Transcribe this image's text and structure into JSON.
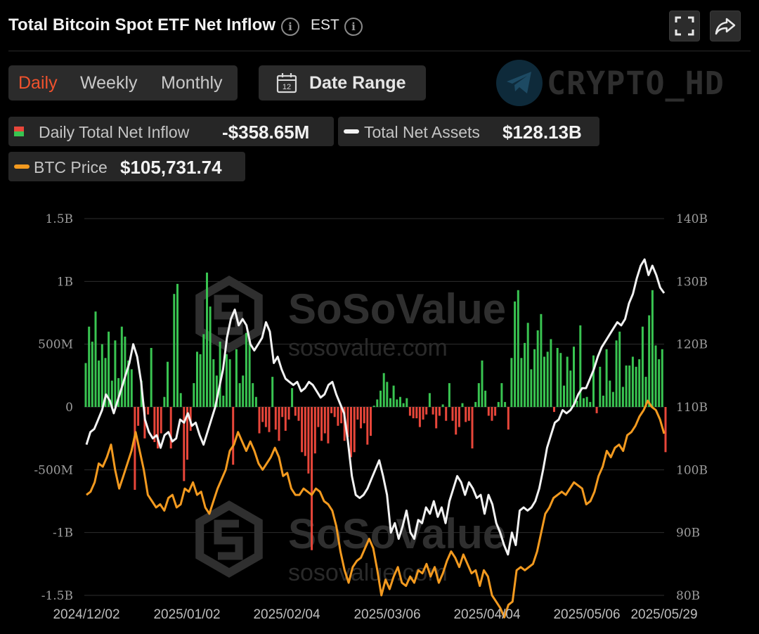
{
  "header": {
    "title": "Total Bitcoin Spot ETF Net Inflow",
    "timezone": "EST",
    "icons": [
      "info-icon",
      "info-icon",
      "fullscreen-icon",
      "share-icon"
    ]
  },
  "controls": {
    "periods": [
      "Daily",
      "Weekly",
      "Monthly"
    ],
    "active_period": "Daily",
    "date_range_label": "Date Range",
    "calendar_day": "12"
  },
  "brand_watermark": "CRYPTO_HD",
  "legend": {
    "inflow": {
      "label": "Daily Total Net Inflow",
      "value": "-$358.65M"
    },
    "assets": {
      "label": "Total Net Assets",
      "value": "$128.13B"
    },
    "price": {
      "label": "BTC Price",
      "value": "$105,731.74"
    }
  },
  "watermark": {
    "name": "SoSoValue",
    "url": "sosovalue.com"
  },
  "colors": {
    "positive": "#39c451",
    "negative": "#e8463a",
    "assets_line": "#f2f2f2",
    "price_line": "#f39a1f",
    "accent": "#f0522d"
  },
  "chart_data": {
    "type": "bar",
    "left_axis": {
      "ticks": [
        "1.5B",
        "1B",
        "500M",
        "0",
        "-500M",
        "-1B",
        "-1.5B"
      ],
      "range": [
        -1.5,
        1.5
      ],
      "unit": "B USD"
    },
    "right_axis": {
      "ticks": [
        "140B",
        "130B",
        "120B",
        "110B",
        "100B",
        "90B",
        "80B"
      ],
      "range": [
        80,
        140
      ],
      "unit": "B USD"
    },
    "x_ticks": [
      "2024/12/02",
      "2025/01/02",
      "2025/02/04",
      "2025/03/06",
      "2025/04/04",
      "2025/05/06",
      "2025/05/29"
    ],
    "grid": true,
    "series": [
      {
        "name": "Daily Total Net Inflow",
        "kind": "bar",
        "axis": "left",
        "unit": "B USD",
        "values": [
          0.35,
          0.64,
          0.52,
          0.76,
          0.37,
          0.5,
          0.39,
          0.6,
          0.21,
          0.53,
          0.23,
          0.64,
          0.56,
          0.37,
          0.3,
          -0.66,
          -0.15,
          0.21,
          -0.25,
          -0.06,
          0.47,
          -0.28,
          -0.33,
          -0.21,
          0.08,
          0.36,
          -0.33,
          0.9,
          0.98,
          0.11,
          -0.59,
          -0.42,
          -0.19,
          0.19,
          0.44,
          0.42,
          0.58,
          1.07,
          0.8,
          0.38,
          0.25,
          0.52,
          0.09,
          0.42,
          0.38,
          -0.46,
          0.46,
          0.19,
          0.25,
          0.59,
          0.54,
          0.19,
          0.08,
          -0.21,
          -0.12,
          -0.16,
          -0.2,
          0.24,
          -0.18,
          -0.27,
          -0.08,
          -0.19,
          -0.1,
          0.15,
          -0.07,
          -0.11,
          -0.36,
          -0.39,
          -0.53,
          -1.14,
          -0.37,
          -0.16,
          -0.27,
          -0.21,
          -0.29,
          -0.05,
          -0.08,
          -0.15,
          -0.13,
          -0.27,
          -0.24,
          -0.4,
          -0.36,
          -0.1,
          -0.17,
          -0.13,
          -0.3,
          -0.23,
          0.01,
          0.06,
          0.13,
          0.27,
          0.2,
          0.07,
          0.17,
          0.06,
          0.08,
          0.03,
          0.07,
          -0.07,
          -0.09,
          -0.09,
          -0.16,
          -0.1,
          -0.06,
          0.11,
          -0.06,
          -0.17,
          -0.07,
          0.02,
          -0.11,
          0.19,
          -0.11,
          -0.22,
          -0.16,
          0.03,
          -0.12,
          -0.11,
          -0.33,
          0.04,
          0.19,
          0.37,
          0.13,
          -0.07,
          -0.11,
          -0.07,
          0.04,
          0.19,
          0.04,
          -0.18,
          0.39,
          0.84,
          0.93,
          0.39,
          0.51,
          0.67,
          0.3,
          0.46,
          0.61,
          0.74,
          0.4,
          0.44,
          0.54,
          -0.04,
          0.47,
          0.43,
          0.17,
          0.4,
          0.29,
          0.48,
          0.05,
          0.65,
          0.07,
          0.08,
          0.04,
          0.41,
          -0.05,
          0.32,
          0.09,
          0.46,
          0.21,
          0.12,
          0.53,
          0.6,
          0.16,
          0.33,
          0.33,
          0.4,
          0.32,
          0.38,
          0.64,
          0.24,
          0.73,
          0.93,
          0.49,
          0.38,
          0.46,
          -0.36
        ],
        "colors": {
          "positive": "#39c451",
          "negative": "#e8463a"
        }
      },
      {
        "name": "Total Net Assets",
        "kind": "line",
        "axis": "right",
        "unit": "B USD",
        "values": [
          104.0,
          106.0,
          106.5,
          108.0,
          109.5,
          112.0,
          111.0,
          109.0,
          111.0,
          113.0,
          115.0,
          117.0,
          120.0,
          118.0,
          114.0,
          108.0,
          106.0,
          105.0,
          105.5,
          103.5,
          105.5,
          106.0,
          104.5,
          105.0,
          108.0,
          107.5,
          109.0,
          107.0,
          107.5,
          105.5,
          104.0,
          106.0,
          108.0,
          110.0,
          113.0,
          116.0,
          121.0,
          124.0,
          125.5,
          123.0,
          124.0,
          123.0,
          120.0,
          119.0,
          120.0,
          121.0,
          123.5,
          122.0,
          117.0,
          118.0,
          116.0,
          114.5,
          114.0,
          113.5,
          114.0,
          112.5,
          113.0,
          114.0,
          113.5,
          112.5,
          111.5,
          112.0,
          113.5,
          114.0,
          112.0,
          110.5,
          109.0,
          104.5,
          99.0,
          96.0,
          95.5,
          96.0,
          97.0,
          98.5,
          100.0,
          101.5,
          99.0,
          96.0,
          90.0,
          91.5,
          89.0,
          91.0,
          93.5,
          90.0,
          89.0,
          92.0,
          91.5,
          94.0,
          93.0,
          95.0,
          92.5,
          94.0,
          91.5,
          95.0,
          97.0,
          99.0,
          98.0,
          96.0,
          98.0,
          97.0,
          95.5,
          96.0,
          93.0,
          96.0,
          94.5,
          91.5,
          90.0,
          88.0,
          86.5,
          90.0,
          88.0,
          93.5,
          94.0,
          93.5,
          94.0,
          95.0,
          97.0,
          100.0,
          103.5,
          105.5,
          107.5,
          108.0,
          109.5,
          109.0,
          109.5,
          110.5,
          112.0,
          113.0,
          113.0,
          114.5,
          116.0,
          118.0,
          119.5,
          120.5,
          121.5,
          122.5,
          123.5,
          123.0,
          124.0,
          126.5,
          128.0,
          130.5,
          132.5,
          133.5,
          131.0,
          132.5,
          131.0,
          129.0,
          128.13
        ]
      },
      {
        "name": "BTC Price",
        "kind": "line",
        "axis": "right",
        "unit": "USD",
        "values": [
          96000,
          96500,
          98000,
          101000,
          100500,
          102000,
          104000,
          100000,
          97000,
          99000,
          101000,
          103000,
          106000,
          103000,
          100000,
          96000,
          95000,
          94000,
          94500,
          93500,
          95500,
          96000,
          94000,
          94500,
          97000,
          96500,
          98000,
          96000,
          96500,
          94000,
          93000,
          95000,
          97000,
          98500,
          100000,
          103000,
          104000,
          106000,
          104500,
          103000,
          104500,
          103000,
          101000,
          100000,
          101000,
          102000,
          103500,
          102000,
          99000,
          99500,
          97000,
          96000,
          96000,
          97000,
          96500,
          96000,
          97000,
          96500,
          95000,
          94500,
          93500,
          91000,
          87000,
          84000,
          82000,
          84500,
          85500,
          86000,
          87500,
          89000,
          87500,
          84000,
          80000,
          82500,
          81000,
          83000,
          84500,
          82000,
          81500,
          83000,
          82000,
          84000,
          83500,
          85000,
          83000,
          84500,
          82000,
          83500,
          85500,
          87000,
          86000,
          84500,
          86500,
          85000,
          83500,
          84000,
          81500,
          84000,
          83000,
          80000,
          79000,
          78000,
          76500,
          78500,
          79000,
          84000,
          84500,
          84000,
          84500,
          85000,
          87000,
          90000,
          93000,
          94000,
          95500,
          96000,
          96500,
          96000,
          97000,
          98000,
          97500,
          97000,
          94500,
          95000,
          96500,
          99000,
          100500,
          103000,
          102000,
          103500,
          104000,
          103000,
          105500,
          106000,
          107000,
          108500,
          109500,
          111000,
          110000,
          109500,
          108000,
          105731.74
        ]
      }
    ]
  }
}
